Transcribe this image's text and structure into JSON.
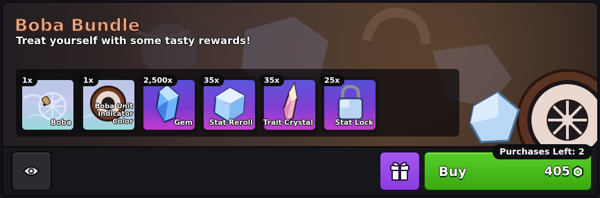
{
  "bundle": {
    "title": "Boba Bundle",
    "subtitle": "Treat yourself with some tasty rewards!"
  },
  "items": [
    {
      "quantity": "1x",
      "name": "Boba",
      "icon": "boba-wheel-icon"
    },
    {
      "quantity": "1x",
      "name": "Boba Unit Indicator Color",
      "name_lines": [
        "Boba Unit",
        "Indicator",
        "Color"
      ],
      "icon": "boba-indicator-icon"
    },
    {
      "quantity": "2,500x",
      "name": "Gem",
      "icon": "gem-icon"
    },
    {
      "quantity": "35x",
      "name": "Stat Reroll",
      "icon": "stat-reroll-cube-icon"
    },
    {
      "quantity": "35x",
      "name": "Trait Crystal",
      "icon": "trait-crystal-icon"
    },
    {
      "quantity": "25x",
      "name": "Stat Lock",
      "icon": "stat-lock-icon"
    }
  ],
  "footer": {
    "preview_icon": "eye-icon",
    "gift_icon": "gift-icon",
    "buy_label": "Buy",
    "price": "405",
    "currency_icon": "robux-icon",
    "purchases_left": "Purchases Left: 2"
  },
  "colors": {
    "title": "#e4a887",
    "buy_button": "#4bbd1d",
    "gift_button": "#9a4ae8",
    "item_card_purple": "#7a3ad0",
    "item_card_light": "#c3c8ec"
  }
}
